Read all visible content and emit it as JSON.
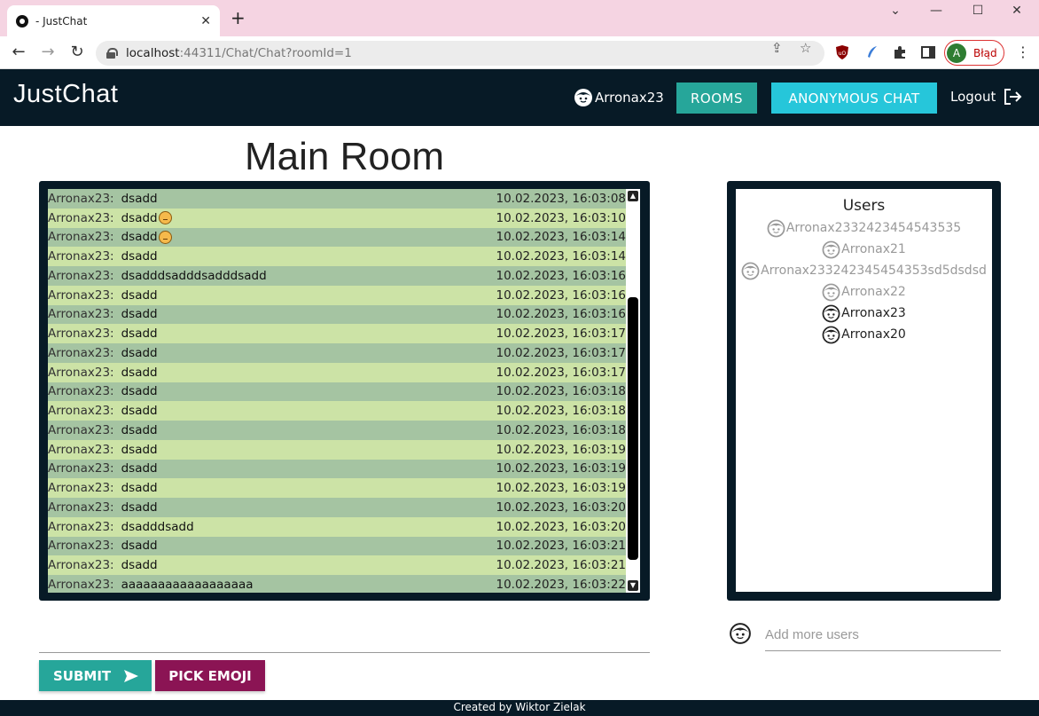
{
  "browser": {
    "tab_title": "- JustChat",
    "url_host": "localhost",
    "url_rest": ":44311/Chat/Chat?roomId=1",
    "profile_initial": "A",
    "profile_label": "Błąd"
  },
  "nav": {
    "brand": "JustChat",
    "username": "Arronax23",
    "rooms_label": "ROOMS",
    "anon_label": "ANONYMOUS CHAT",
    "logout_label": "Logout"
  },
  "room": {
    "title": "Main Room"
  },
  "messages": [
    {
      "author": "Arronax23:",
      "text": "dsadd",
      "emoji": false,
      "time": "10.02.2023, 16:03:08"
    },
    {
      "author": "Arronax23:",
      "text": "dsadd",
      "emoji": true,
      "time": "10.02.2023, 16:03:10"
    },
    {
      "author": "Arronax23:",
      "text": "dsadd",
      "emoji": true,
      "time": "10.02.2023, 16:03:14"
    },
    {
      "author": "Arronax23:",
      "text": "dsadd",
      "emoji": false,
      "time": "10.02.2023, 16:03:14"
    },
    {
      "author": "Arronax23:",
      "text": "dsadddsadddsadddsadd",
      "emoji": false,
      "time": "10.02.2023, 16:03:16"
    },
    {
      "author": "Arronax23:",
      "text": "dsadd",
      "emoji": false,
      "time": "10.02.2023, 16:03:16"
    },
    {
      "author": "Arronax23:",
      "text": "dsadd",
      "emoji": false,
      "time": "10.02.2023, 16:03:16"
    },
    {
      "author": "Arronax23:",
      "text": "dsadd",
      "emoji": false,
      "time": "10.02.2023, 16:03:17"
    },
    {
      "author": "Arronax23:",
      "text": "dsadd",
      "emoji": false,
      "time": "10.02.2023, 16:03:17"
    },
    {
      "author": "Arronax23:",
      "text": "dsadd",
      "emoji": false,
      "time": "10.02.2023, 16:03:17"
    },
    {
      "author": "Arronax23:",
      "text": "dsadd",
      "emoji": false,
      "time": "10.02.2023, 16:03:18"
    },
    {
      "author": "Arronax23:",
      "text": "dsadd",
      "emoji": false,
      "time": "10.02.2023, 16:03:18"
    },
    {
      "author": "Arronax23:",
      "text": "dsadd",
      "emoji": false,
      "time": "10.02.2023, 16:03:18"
    },
    {
      "author": "Arronax23:",
      "text": "dsadd",
      "emoji": false,
      "time": "10.02.2023, 16:03:19"
    },
    {
      "author": "Arronax23:",
      "text": "dsadd",
      "emoji": false,
      "time": "10.02.2023, 16:03:19"
    },
    {
      "author": "Arronax23:",
      "text": "dsadd",
      "emoji": false,
      "time": "10.02.2023, 16:03:19"
    },
    {
      "author": "Arronax23:",
      "text": "dsadd",
      "emoji": false,
      "time": "10.02.2023, 16:03:20"
    },
    {
      "author": "Arronax23:",
      "text": "dsadddsadd",
      "emoji": false,
      "time": "10.02.2023, 16:03:20"
    },
    {
      "author": "Arronax23:",
      "text": "dsadd",
      "emoji": false,
      "time": "10.02.2023, 16:03:21"
    },
    {
      "author": "Arronax23:",
      "text": "dsadd",
      "emoji": false,
      "time": "10.02.2023, 16:03:21"
    },
    {
      "author": "Arronax23:",
      "text": "aaaaaaaaaaaaaaaaaa",
      "emoji": false,
      "time": "10.02.2023, 16:03:22"
    }
  ],
  "composer": {
    "submit_label": "SUBMIT",
    "emoji_label": "PICK EMOJI"
  },
  "users": {
    "title": "Users",
    "list": [
      {
        "name": "Arronax2332423454543535",
        "online": false
      },
      {
        "name": "Arronax21",
        "online": false
      },
      {
        "name": "Arronax233242345454353sd5dsdsd",
        "online": false
      },
      {
        "name": "Arronax22",
        "online": false
      },
      {
        "name": "Arronax23",
        "online": true
      },
      {
        "name": "Arronax20",
        "online": true
      }
    ],
    "add_placeholder": "Add more users"
  },
  "footer": {
    "text": "Created by Wiktor Zielak"
  },
  "colors": {
    "navbar": "#071a26",
    "rooms_button": "#26a69a",
    "anon_button": "#26c6da",
    "emoji_button": "#8b1454",
    "row_dark": "#a5c4a2",
    "row_light": "#cce3a6"
  }
}
